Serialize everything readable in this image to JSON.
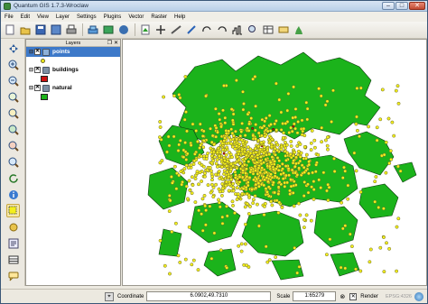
{
  "window": {
    "title": "Quantum GIS 1.7.3-Wroclaw",
    "min_label": "–",
    "max_label": "□",
    "close_label": "✕"
  },
  "menu": [
    "File",
    "Edit",
    "View",
    "Layer",
    "Settings",
    "Plugins",
    "Vector",
    "Raster",
    "Help"
  ],
  "toolbar_icons": [
    "folder-open-icon",
    "layers-icon",
    "save-icon",
    "undo-icon",
    "pan-icon",
    "zoom-in-icon",
    "zoom-out-icon",
    "refresh-icon"
  ],
  "left_tools": [
    "pan-icon",
    "zoom-in-icon",
    "zoom-out-icon",
    "zoom-full-icon",
    "zoom-layer-icon",
    "identify-icon",
    "measure-icon",
    "select-icon",
    "info-icon",
    "chart-icon",
    "tips-icon"
  ],
  "layers_panel": {
    "title": "Layers",
    "expand_symbol": "⊟",
    "items": [
      {
        "name": "points",
        "checked": "✕",
        "selected": true,
        "symbol": "point"
      },
      {
        "name": "buildings",
        "checked": "✕",
        "selected": false,
        "symbol": "poly-red"
      },
      {
        "name": "natural",
        "checked": "✕",
        "selected": false,
        "symbol": "poly-green"
      }
    ]
  },
  "colors": {
    "natural_fill": "#1bb31b",
    "natural_stroke": "#0c3c0c",
    "buildings_fill": "#cc1111",
    "points_fill": "#f4ef1b",
    "points_stroke": "#6b6a2a",
    "selected_row": "#3d79c9"
  },
  "status": {
    "coordinate_label": "Coordinate",
    "coordinate_value": "6.0902,49.7310",
    "scale_label": "Scale",
    "scale_value": "1:65279",
    "render_check": "✕",
    "render_label": "Render",
    "crs_label": "EPSG:4326"
  }
}
